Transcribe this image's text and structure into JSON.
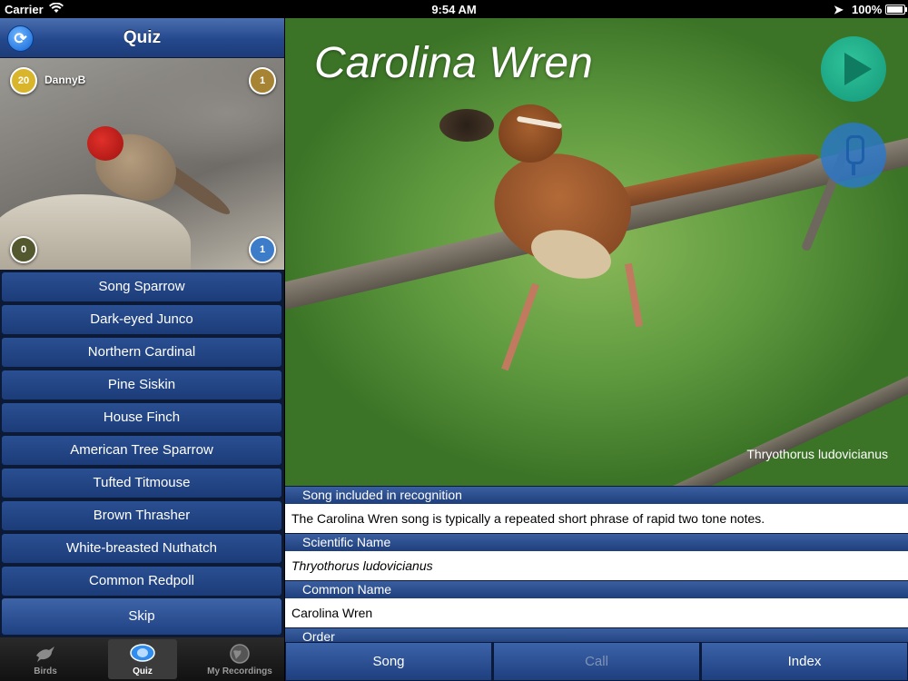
{
  "status_bar": {
    "carrier": "Carrier",
    "time": "9:54 AM",
    "battery": "100%"
  },
  "quiz": {
    "title": "Quiz",
    "user": "DannyB",
    "scores": {
      "top_left": "20",
      "top_right": "1",
      "bottom_left": "0",
      "bottom_right": "1"
    },
    "answers": [
      "Song Sparrow",
      "Dark-eyed Junco",
      "Northern Cardinal",
      "Pine Siskin",
      "House Finch",
      "American Tree Sparrow",
      "Tufted Titmouse",
      "Brown Thrasher",
      "White-breasted Nuthatch",
      "Common Redpoll"
    ],
    "skip_label": "Skip"
  },
  "tabs": {
    "birds": "Birds",
    "quiz": "Quiz",
    "recordings": "My Recordings",
    "selected": "Quiz"
  },
  "detail": {
    "title": "Carolina Wren",
    "scientific_caption": "Thryothorus ludovicianus",
    "sections": [
      {
        "header": "Song included in recognition",
        "value": "The Carolina Wren song is typically a repeated short phrase of rapid two tone notes."
      },
      {
        "header": "Scientific Name",
        "value": "Thryothorus ludovicianus"
      },
      {
        "header": "Common Name",
        "value": "Carolina Wren"
      },
      {
        "header": "Order",
        "value": ""
      }
    ]
  },
  "bottom_buttons": {
    "song": "Song",
    "call": "Call",
    "index": "Index"
  },
  "colors": {
    "accent_blue": "#24488c",
    "play_green": "#13977a",
    "mic_blue": "#2978cd"
  },
  "icons": {
    "refresh": "refresh-icon",
    "play": "play-icon",
    "microphone": "microphone-icon"
  }
}
